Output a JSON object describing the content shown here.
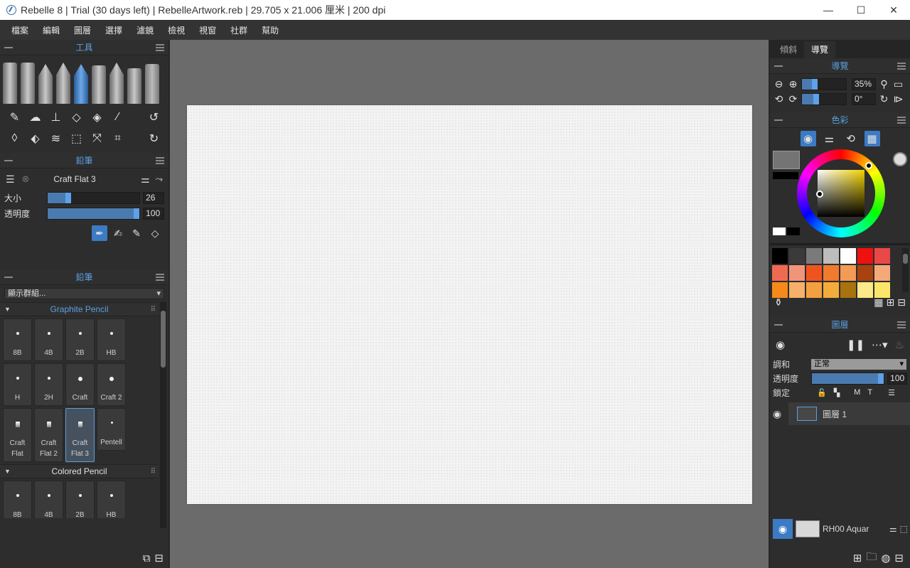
{
  "window": {
    "title": "Rebelle 8 | Trial (30 days left) | RebelleArtwork.reb | 29.705 x 21.006 厘米 | 200 dpi",
    "minimize": "—",
    "maximize": "☐",
    "close": "✕"
  },
  "menu": [
    "檔案",
    "編輯",
    "圖層",
    "選擇",
    "濾鏡",
    "檢視",
    "視窗",
    "社群",
    "幫助"
  ],
  "tools_panel": {
    "title": "工具"
  },
  "brush_panel": {
    "title": "鉛筆",
    "brush_name": "Craft Flat 3",
    "size_label": "大小",
    "size_value": "26",
    "size_fraction": 0.26,
    "opacity_label": "透明度",
    "opacity_value": "100",
    "opacity_fraction": 1.0
  },
  "presets_panel": {
    "title": "鉛筆",
    "group_filter": "顯示群組...",
    "groups": [
      {
        "name": "Graphite Pencil",
        "items": [
          "8B",
          "4B",
          "2B",
          "HB",
          "H",
          "2H",
          "Craft",
          "Craft 2",
          "Craft Flat",
          "Craft Flat 2",
          "Craft Flat 3",
          "Pentell"
        ]
      },
      {
        "name": "Colored Pencil",
        "items": [
          "8B",
          "4B",
          "2B",
          "HB"
        ]
      }
    ]
  },
  "right_tabs": [
    "傾斜",
    "導覽"
  ],
  "navigator": {
    "title": "導覽",
    "zoom": "35%",
    "zoom_fraction": 0.35,
    "rotation": "0°",
    "rotation_fraction": 0.38
  },
  "color": {
    "title": "色彩",
    "current": "#747474",
    "previous": "#000000"
  },
  "palette": [
    "#000000",
    "#3a3a3a",
    "#7a7a7a",
    "#bdbdbd",
    "#ffffff",
    "#ee1111",
    "#e94848",
    "#f06a52",
    "#f2947c",
    "#f0541e",
    "#f07a2e",
    "#f39a56",
    "#a9420e",
    "#f5a878",
    "#f58a1a",
    "#f7b069",
    "#f5a040",
    "#f3ac3c",
    "#a8720e",
    "#fbe98a",
    "#fbe66a"
  ],
  "layers": {
    "title": "圖層",
    "blend_label": "調和",
    "blend_value": "正常",
    "opacity_label": "透明度",
    "opacity_value": "100",
    "opacity_fraction": 1.0,
    "lock_label": "鎖定",
    "lock_m": "M",
    "lock_t": "T",
    "layer_name": "圖層 1",
    "paper_name": "RH00 Aquar"
  }
}
